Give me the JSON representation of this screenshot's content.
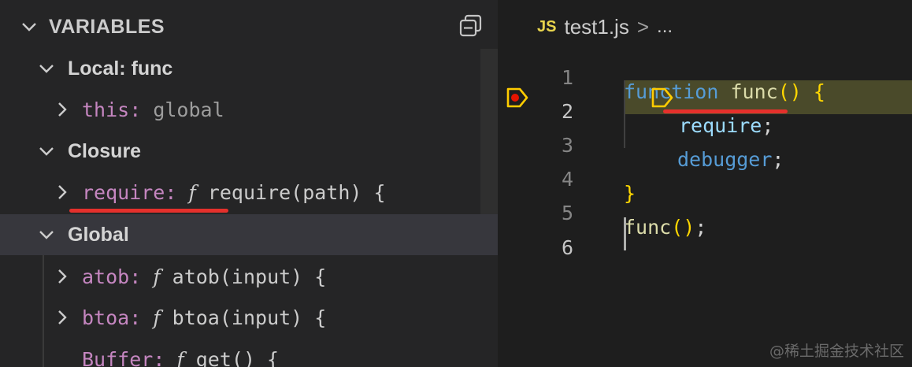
{
  "variables_panel": {
    "title": "VARIABLES",
    "scopes": [
      {
        "label": "Local: func",
        "vars": [
          {
            "name": "this",
            "value": "global"
          }
        ]
      },
      {
        "label": "Closure",
        "vars": [
          {
            "name": "require",
            "fn_marker": "f",
            "value": "require(path) {"
          }
        ]
      },
      {
        "label": "Global",
        "vars": [
          {
            "name": "atob",
            "fn_marker": "f",
            "value": "atob(input) {"
          },
          {
            "name": "btoa",
            "fn_marker": "f",
            "value": "btoa(input) {"
          },
          {
            "name": "Buffer",
            "fn_marker": "f",
            "value": "get() {"
          }
        ]
      }
    ]
  },
  "editor": {
    "language_badge": "JS",
    "filename": "test1.js",
    "breadcrumb_separator": ">",
    "breadcrumb_more": "...",
    "line_numbers": [
      "1",
      "2",
      "3",
      "4",
      "5",
      "6"
    ],
    "current_line": "2",
    "code": {
      "l1_kw": "function",
      "l1_fn": "func",
      "l1_paren": "()",
      "l1_brace": "{",
      "l2_id": "require",
      "l2_end": ";",
      "l3_id": "debugger",
      "l3_end": ";",
      "l4_brace": "}",
      "l5_fn": "func",
      "l5_paren": "()",
      "l5_end": ";"
    }
  },
  "watermark": "@稀土掘金技术社区",
  "colors": {
    "panel_bg": "#252526",
    "editor_bg": "#1e1e1e",
    "selected_row": "#37373d",
    "annotation_red": "#e5302c",
    "debug_line": "#4a4a2a",
    "breakpoint": "#e51400",
    "debug_arrow": "#ffcc00"
  }
}
